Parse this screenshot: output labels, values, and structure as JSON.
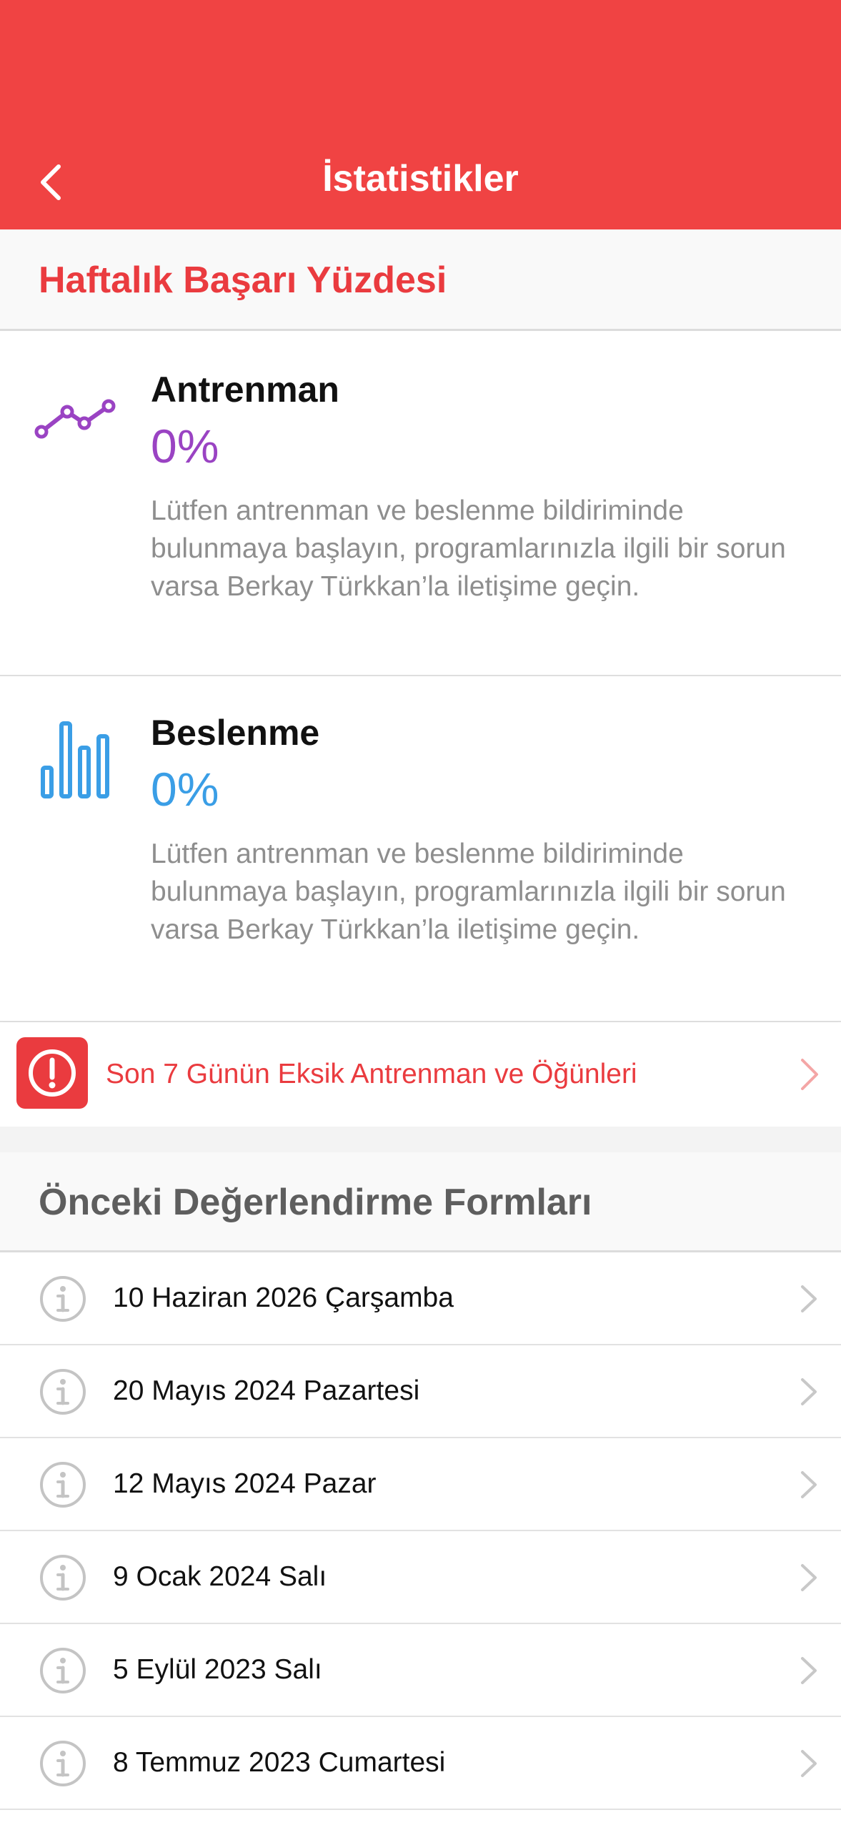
{
  "header": {
    "title": "İstatistikler",
    "back_icon": "chevron-left-icon"
  },
  "weekly": {
    "heading": "Haftalık Başarı Yüzdesi",
    "training": {
      "name": "Antrenman",
      "percent": "0%",
      "description": "Lütfen antrenman ve beslenme bildiriminde bulunmaya başlayın, programlarınızla ilgili bir sorun varsa Berkay Türkkan’la iletişime geçin.",
      "icon": "line-chart-icon",
      "color": "#9a43c3"
    },
    "nutrition": {
      "name": "Beslenme",
      "percent": "0%",
      "description": "Lütfen antrenman ve beslenme bildiriminde bulunmaya başlayın, programlarınızla ilgili bir sorun varsa Berkay Türkkan’la iletişime geçin.",
      "icon": "bar-chart-icon",
      "color": "#3a9ee6"
    },
    "missing": {
      "label": "Son 7 Günün Eksik Antrenman ve Öğünleri",
      "icon": "exclamation-icon"
    }
  },
  "forms": {
    "heading": "Önceki Değerlendirme Formları",
    "items": [
      {
        "label": "10 Haziran 2026 Çarşamba"
      },
      {
        "label": "20 Mayıs 2024 Pazartesi"
      },
      {
        "label": "12 Mayıs 2024 Pazar"
      },
      {
        "label": "9 Ocak 2024 Salı"
      },
      {
        "label": "5 Eylül 2023 Salı"
      },
      {
        "label": "8 Temmuz 2023 Cumartesi"
      }
    ]
  },
  "colors": {
    "brand_red": "#f04343",
    "text_red": "#ea3b3f"
  }
}
